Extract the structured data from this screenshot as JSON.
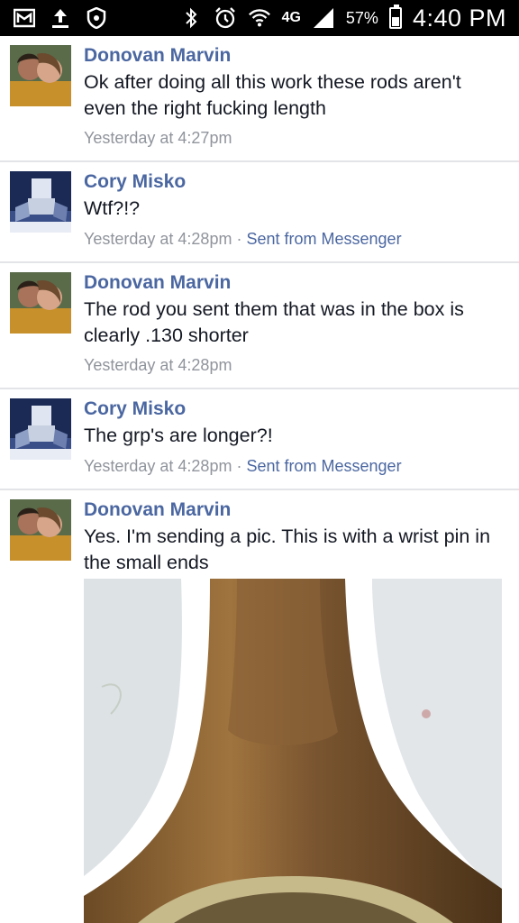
{
  "status_bar": {
    "icons_left": [
      "gmail-icon",
      "upload-icon",
      "shield-icon"
    ],
    "icons_right": [
      "bluetooth-icon",
      "alarm-icon",
      "wifi-icon",
      "network-4g-icon",
      "signal-icon"
    ],
    "network": "4G",
    "battery": "57%",
    "battery_level": 0.57,
    "time": "4:40 PM"
  },
  "comments": [
    {
      "author": "Donovan Marvin",
      "line1": "Ok after doing all this work these rods aren't",
      "line2": "even the right fucking length",
      "time": "Yesterday at 4:27pm",
      "source": ""
    },
    {
      "author": "Cory Misko",
      "line1": "Wtf?!?",
      "line2": "",
      "time": "Yesterday at 4:28pm",
      "separator": "·",
      "source": "Sent from Messenger"
    },
    {
      "author": "Donovan Marvin",
      "line1": "The rod you sent them that was in the box is",
      "line2": "clearly .130 shorter",
      "time": "Yesterday at 4:28pm",
      "source": ""
    },
    {
      "author": "Cory Misko",
      "line1": "The grp's are longer?!",
      "line2": "",
      "time": "Yesterday at 4:28pm",
      "separator": "·",
      "source": "Sent from Messenger"
    },
    {
      "author": "Donovan Marvin",
      "line1": "Yes. I'm sending a pic. This is with a wrist pin in",
      "line2": "the small ends",
      "time": "",
      "source": ""
    }
  ],
  "colors": {
    "author_link": "#4b67a1",
    "meta_gray": "#90949c",
    "divider": "#e3e4e8",
    "status_bar_bg": "#000000"
  }
}
